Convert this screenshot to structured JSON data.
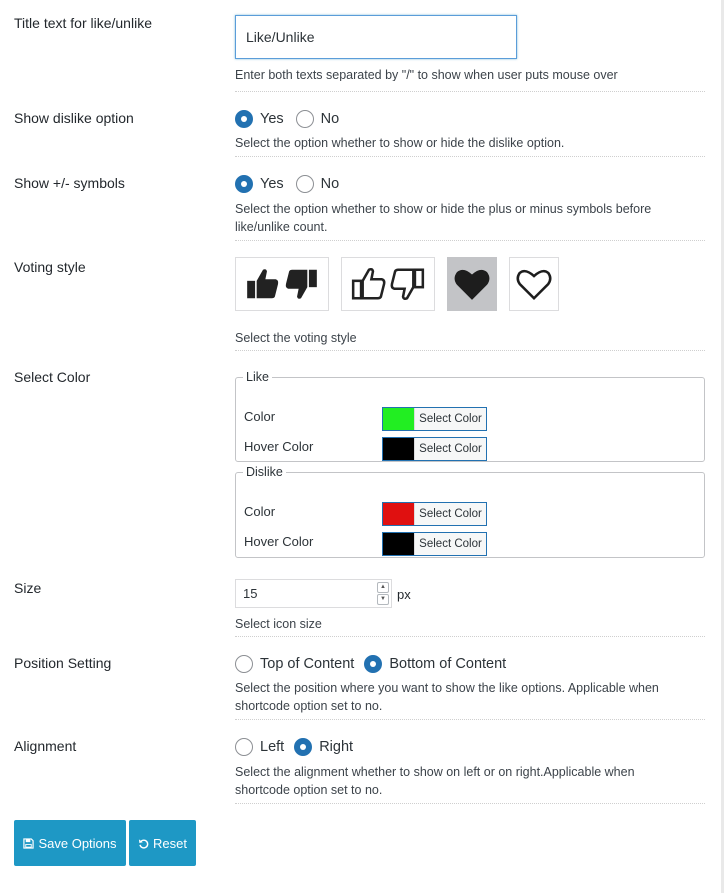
{
  "title_text": {
    "label": "Title text for like/unlike",
    "value": "Like/Unlike",
    "description": "Enter both texts separated by \"/\" to show when user puts mouse over"
  },
  "show_dislike": {
    "label": "Show dislike option",
    "yes": "Yes",
    "no": "No",
    "selected": "Yes",
    "description": "Select the option whether to show or hide the dislike option."
  },
  "show_symbols": {
    "label": "Show +/- symbols",
    "yes": "Yes",
    "no": "No",
    "selected": "Yes",
    "description_line1": "Select the option whether to show or hide the plus or minus symbols before",
    "description_line2": "like/unlike count."
  },
  "voting_style": {
    "label": "Voting style",
    "options": [
      "thumbs-solid",
      "thumbs-outline",
      "heart-solid",
      "heart-outline"
    ],
    "selected": "heart-solid",
    "description": "Select the voting style"
  },
  "select_color": {
    "label": "Select Color",
    "like": {
      "legend": "Like",
      "color_label": "Color",
      "color": "#22ee22",
      "hover_label": "Hover Color",
      "hover_color": "#000000",
      "button": "Select Color"
    },
    "dislike": {
      "legend": "Dislike",
      "color_label": "Color",
      "color": "#e01010",
      "hover_label": "Hover Color",
      "hover_color": "#000000",
      "button": "Select Color"
    }
  },
  "size": {
    "label": "Size",
    "value": "15",
    "unit": "px",
    "description": "Select icon size"
  },
  "position": {
    "label": "Position Setting",
    "top": "Top of Content",
    "bottom": "Bottom of Content",
    "selected": "Bottom of Content",
    "description_line1": "Select the position where you want to show the like options. Applicable when",
    "description_line2": "shortcode option set to no."
  },
  "alignment": {
    "label": "Alignment",
    "left": "Left",
    "right": "Right",
    "selected": "Right",
    "description_line1": "Select the alignment whether to show on left or on right.Applicable when",
    "description_line2": "shortcode option set to no."
  },
  "actions": {
    "save": "Save Options",
    "reset": "Reset"
  },
  "colors": {
    "accent": "#2271b1",
    "button": "#1e98c5"
  }
}
